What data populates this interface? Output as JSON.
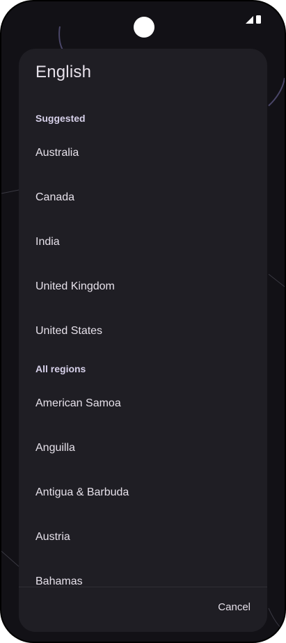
{
  "dialog": {
    "title": "English",
    "suggested_header": "Suggested",
    "suggested": [
      "Australia",
      "Canada",
      "India",
      "United Kingdom",
      "United States"
    ],
    "all_header": "All regions",
    "all_regions": [
      "American Samoa",
      "Anguilla",
      "Antigua & Barbuda",
      "Austria",
      "Bahamas"
    ],
    "cancel_label": "Cancel"
  },
  "colors": {
    "dialog_bg": "#1f1e24",
    "screen_bg": "#121116",
    "text": "#e6e1ea",
    "section_header": "#d7d1ea"
  },
  "icons": [
    "camera-cutout",
    "signal-icon",
    "battery-icon"
  ]
}
